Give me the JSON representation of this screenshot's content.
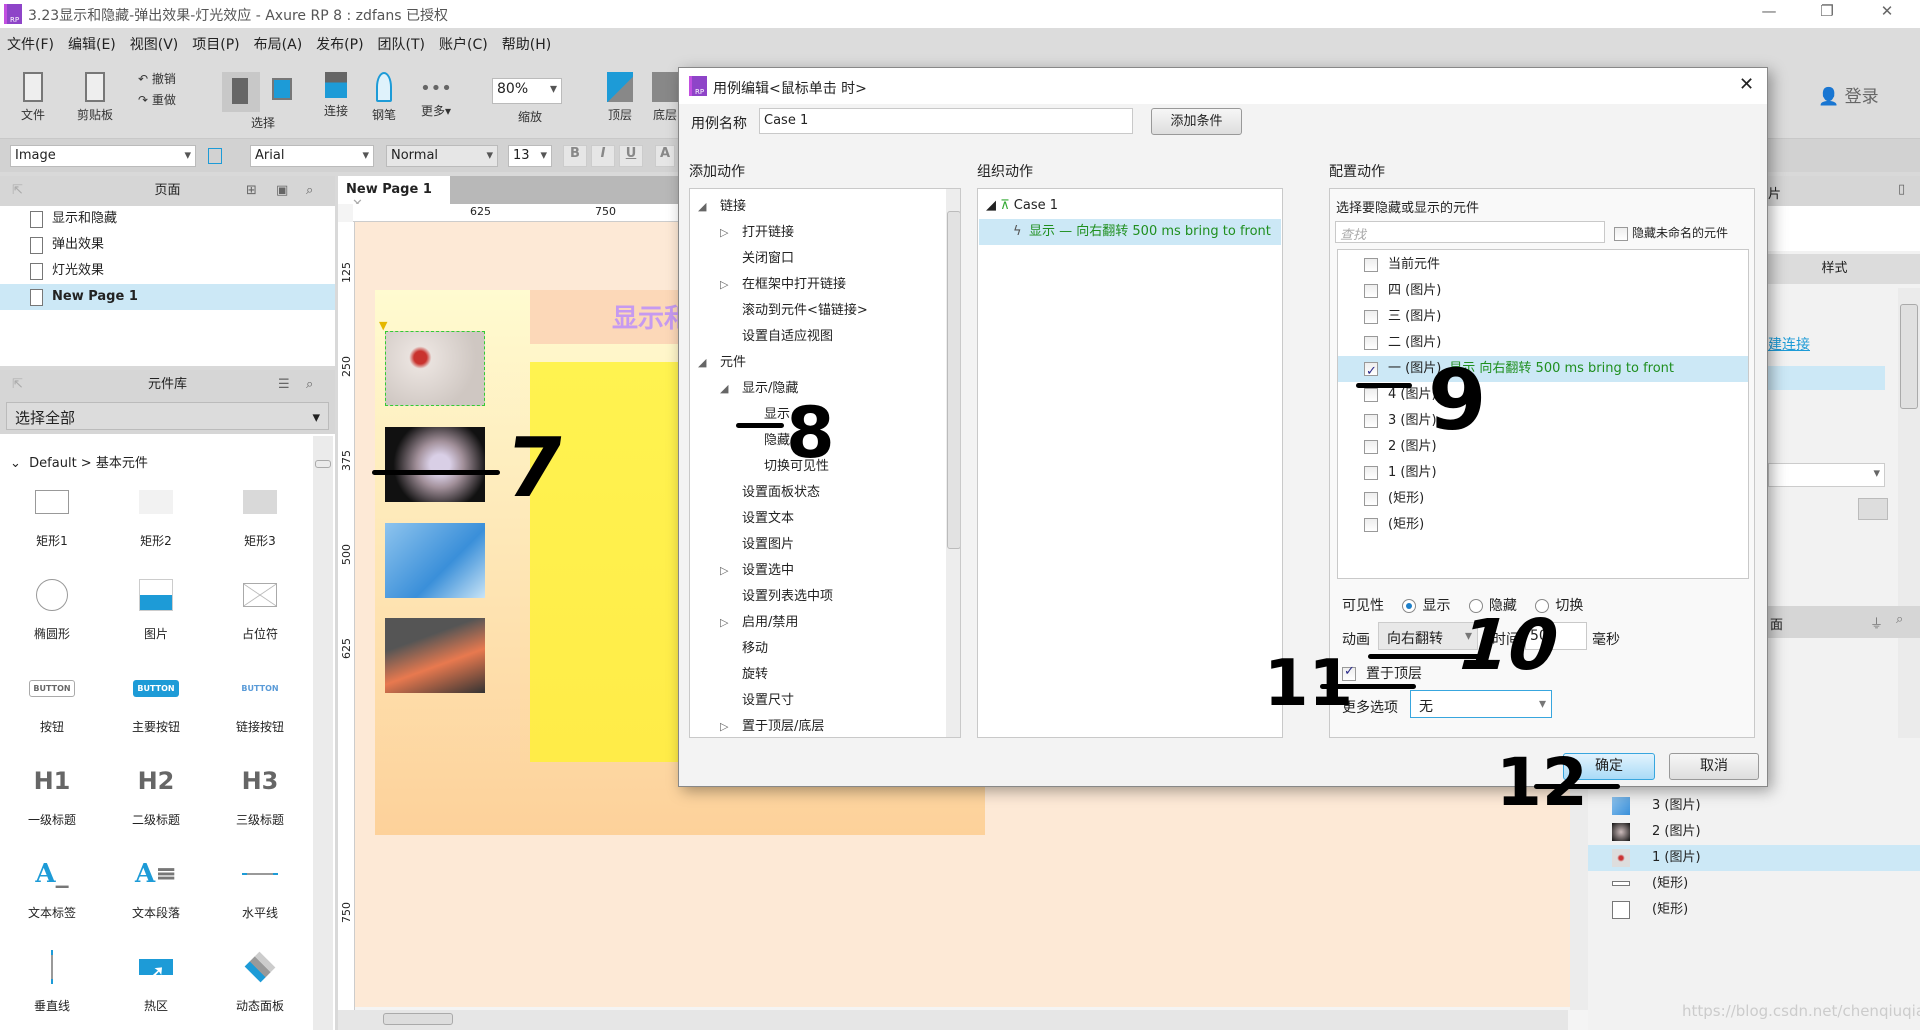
{
  "window": {
    "title": "3.23显示和隐藏-弹出效果-灯光效应 - Axure RP 8 : zdfans 已授权",
    "logo": "RP"
  },
  "menu": [
    "文件(F)",
    "编辑(E)",
    "视图(V)",
    "项目(P)",
    "布局(A)",
    "发布(P)",
    "团队(T)",
    "账户(C)",
    "帮助(H)"
  ],
  "toolbar": {
    "file": "文件",
    "clipboard": "剪贴板",
    "undo": "撤销",
    "redo": "重做",
    "select": "选择",
    "connect": "连接",
    "pen": "钢笔",
    "more": "更多▾",
    "zoom_value": "80%",
    "zoom_label": "缩放",
    "top": "顶层",
    "bottom": "底层",
    "login": "登录"
  },
  "format": {
    "widget_type": "Image",
    "font": "Arial",
    "weight": "Normal",
    "size": "13",
    "bold": "B",
    "italic": "I",
    "underline": "U"
  },
  "pages": {
    "title": "页面",
    "items": [
      "显示和隐藏",
      "弹出效果",
      "灯光效果",
      "New Page 1"
    ],
    "selected": "New Page 1"
  },
  "library": {
    "title": "元件库",
    "filter": "选择全部",
    "group": "Default > 基本元件",
    "widgets": [
      "矩形1",
      "矩形2",
      "矩形3",
      "椭圆形",
      "图片",
      "占位符",
      "按钮",
      "主要按钮",
      "链接按钮",
      "一级标题",
      "二级标题",
      "三级标题",
      "文本标签",
      "文本段落",
      "水平线",
      "垂直线",
      "热区",
      "动态面板"
    ],
    "button_text": "BUTTON",
    "h1": "H1",
    "h2": "H2",
    "h3": "H3"
  },
  "canvas": {
    "tab": "New Page 1",
    "ruler_h": [
      "625",
      "750"
    ],
    "ruler_v": [
      "125",
      "250",
      "375",
      "500",
      "625",
      "750"
    ],
    "heading_partial": "显示和"
  },
  "dialog": {
    "title": "用例编辑<鼠标单击 时>",
    "case_name_label": "用例名称",
    "case_name": "Case 1",
    "add_condition": "添加条件",
    "add_action_title": "添加动作",
    "organize_title": "组织动作",
    "configure_title": "配置动作",
    "actions": [
      {
        "label": "链接",
        "level": 0,
        "expander": "open"
      },
      {
        "label": "打开链接",
        "level": 1,
        "expander": "closed"
      },
      {
        "label": "关闭窗口",
        "level": 1
      },
      {
        "label": "在框架中打开链接",
        "level": 1,
        "expander": "closed"
      },
      {
        "label": "滚动到元件<锚链接>",
        "level": 1
      },
      {
        "label": "设置自适应视图",
        "level": 1
      },
      {
        "label": "元件",
        "level": 0,
        "expander": "open"
      },
      {
        "label": "显示/隐藏",
        "level": 1,
        "expander": "open"
      },
      {
        "label": "显示",
        "level": 2
      },
      {
        "label": "隐藏",
        "level": 2
      },
      {
        "label": "切换可见性",
        "level": 2
      },
      {
        "label": "设置面板状态",
        "level": 1
      },
      {
        "label": "设置文本",
        "level": 1
      },
      {
        "label": "设置图片",
        "level": 1
      },
      {
        "label": "设置选中",
        "level": 1,
        "expander": "closed"
      },
      {
        "label": "设置列表选中项",
        "level": 1
      },
      {
        "label": "启用/禁用",
        "level": 1,
        "expander": "closed"
      },
      {
        "label": "移动",
        "level": 1
      },
      {
        "label": "旋转",
        "level": 1
      },
      {
        "label": "设置尺寸",
        "level": 1
      },
      {
        "label": "置于顶层/底层",
        "level": 1,
        "expander": "closed"
      }
    ],
    "case_tree": {
      "case": "Case 1",
      "action_verb": "显示",
      "action_detail": " — 向右翻转 500 ms bring to front"
    },
    "config": {
      "select_title": "选择要隐藏或显示的元件",
      "search_placeholder": "查找",
      "hide_unnamed": "隐藏未命名的元件",
      "targets": [
        {
          "label": "当前元件",
          "checked": false
        },
        {
          "label": "四 (图片)",
          "checked": false
        },
        {
          "label": "三 (图片)",
          "checked": false
        },
        {
          "label": "二 (图片)",
          "checked": false
        },
        {
          "label": "一 (图片)",
          "checked": true,
          "note": "显示 向右翻转 500 ms bring to front"
        },
        {
          "label": "4 (图片)",
          "checked": false
        },
        {
          "label": "3 (图片)",
          "checked": false
        },
        {
          "label": "2 (图片)",
          "checked": false
        },
        {
          "label": "1 (图片)",
          "checked": false
        },
        {
          "label": "(矩形)",
          "checked": false
        },
        {
          "label": "(矩形)",
          "checked": false
        }
      ],
      "visibility_label": "可见性",
      "visibility_options": [
        "显示",
        "隐藏",
        "切换"
      ],
      "visibility_selected": "显示",
      "animation_label": "动画",
      "animation": "向右翻转",
      "time_label": "时间",
      "time": "500",
      "ms": "毫秒",
      "bring_front": "置于顶层",
      "bring_front_checked": true,
      "more_label": "更多选项",
      "more_value": "无"
    },
    "ok": "确定",
    "cancel": "取消"
  },
  "right_panel": {
    "tab_partial": "片",
    "style_tab": "样式",
    "link": "建连接",
    "outline_header": "面",
    "outline_items": [
      "3 (图片)",
      "2 (图片)",
      "1 (图片)",
      "(矩形)",
      "(矩形)"
    ],
    "outline_selected": "1 (图片)"
  },
  "annotations": [
    "7",
    "8",
    "9",
    "10",
    "11",
    "12"
  ],
  "watermark": "https://blog.csdn.net/chenqiuqian",
  "colors": {
    "accent": "#1d9bd7",
    "selection": "#cce8f6",
    "green_text": "#1f8f1f",
    "canvas_bg": "#fde9d6",
    "yellow_panel": "#fff350"
  }
}
